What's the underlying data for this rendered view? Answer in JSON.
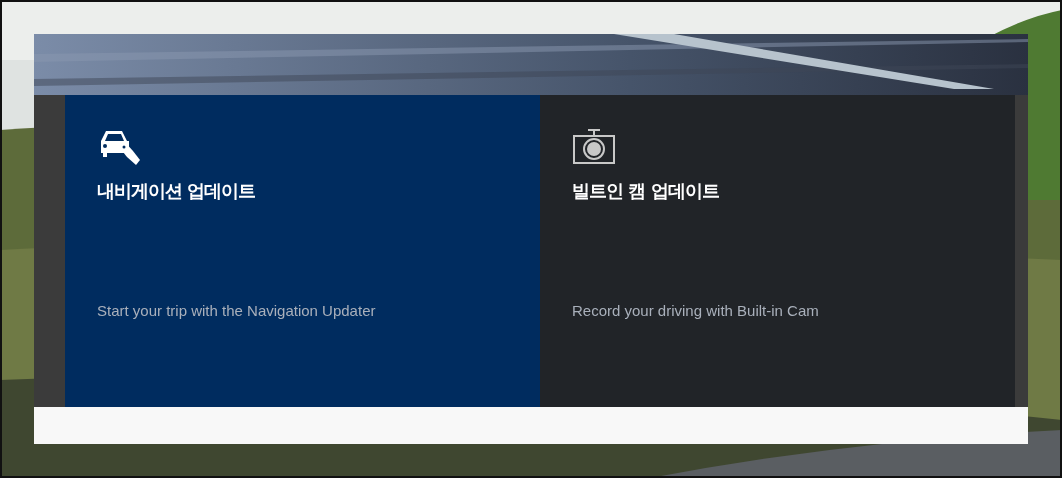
{
  "cards": [
    {
      "kind": "navigation",
      "title": "내비게이션 업데이트",
      "description": "Start your trip with the Navigation Updater"
    },
    {
      "kind": "camera",
      "title": "빌트인 캠 업데이트",
      "description": "Record your driving with Built-in Cam"
    }
  ]
}
